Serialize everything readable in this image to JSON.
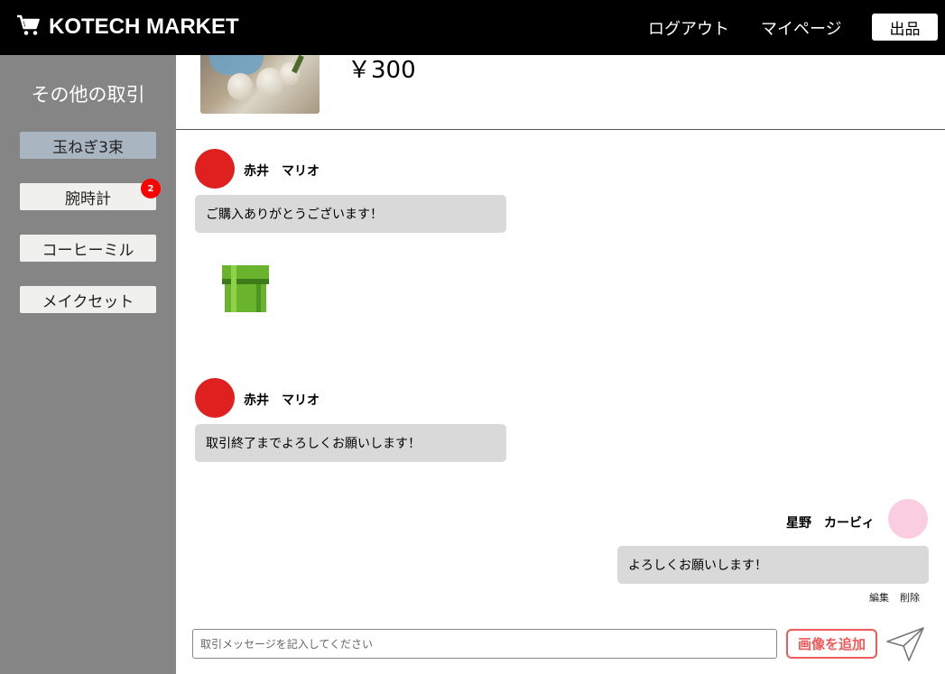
{
  "header": {
    "logo_text": "KOTECH MARKET",
    "logo_icon": "shopping-cart-icon",
    "logout_label": "ログアウト",
    "mypage_label": "マイページ",
    "sell_label": "出品"
  },
  "sidebar": {
    "title": "その他の取引",
    "items": [
      {
        "label": "玉ねぎ3束",
        "active": true
      },
      {
        "label": "腕時計",
        "badge": "2"
      },
      {
        "label": "コーヒーミル"
      },
      {
        "label": "メイクセット"
      }
    ]
  },
  "product": {
    "price": "￥300"
  },
  "messages": [
    {
      "user": "赤井　マリオ",
      "text": "ご購入ありがとうございます！",
      "avatar_color": "#e01f1f"
    },
    {
      "image": "green-pipe-image"
    },
    {
      "user": "赤井　マリオ",
      "text": "取引終了までよろしくお願いします！",
      "avatar_color": "#e01f1f"
    },
    {
      "user": "星野　カービィ",
      "text": "よろしくお願いします！",
      "avatar_color": "#fbcde0",
      "own": true,
      "edit_label": "編集",
      "delete_label": "削除"
    }
  ],
  "composer": {
    "placeholder": "取引メッセージを記入してください",
    "add_image_label": "画像を追加",
    "send_icon": "paper-plane-icon"
  },
  "colors": {
    "header_bg": "#000000",
    "sidebar_bg": "#858585",
    "active_item": "#a9b6c1",
    "badge": "#ff0000",
    "accent": "#f05a5a",
    "bubble": "#d9d9d9"
  }
}
